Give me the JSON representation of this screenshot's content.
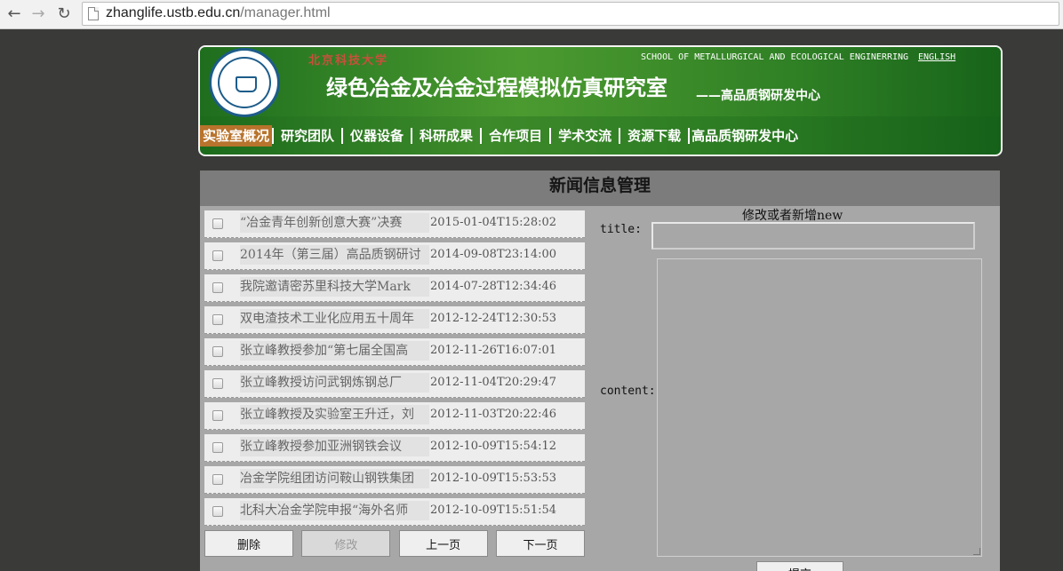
{
  "browser": {
    "url_host": "zhanglife.ustb.edu.cn",
    "url_path": "/manager.html"
  },
  "header": {
    "university": "北京科技大学",
    "school_en": "SCHOOL OF METALLURGICAL AND ECOLOGICAL ENGINERRING",
    "english_link": "ENGLISH",
    "lab_title": "绿色冶金及冶金过程模拟仿真研究室",
    "lab_subtitle": "——高品质钢研发中心",
    "menu": [
      {
        "label": "实验室概况",
        "active": true
      },
      {
        "label": "研究团队"
      },
      {
        "label": "仪器设备"
      },
      {
        "label": "科研成果"
      },
      {
        "label": "合作项目"
      },
      {
        "label": "学术交流"
      },
      {
        "label": "资源下载"
      },
      {
        "label": "高品质钢研发中心"
      }
    ]
  },
  "panel": {
    "title": "新闻信息管理",
    "news": [
      {
        "title": " “冶金青年创新创意大赛”决赛",
        "date": "2015-01-04T15:28:02"
      },
      {
        "title": "2014年（第三届）高品质钢研讨",
        "date": "2014-09-08T23:14:00"
      },
      {
        "title": " 我院邀请密苏里科技大学Mark ",
        "date": "2014-07-28T12:34:46"
      },
      {
        "title": "双电渣技术工业化应用五十周年",
        "date": "2012-12-24T12:30:53"
      },
      {
        "title": "张立峰教授参加“第七届全国高",
        "date": "2012-11-26T16:07:01"
      },
      {
        "title": " 张立峰教授访问武钢炼钢总厂 ",
        "date": "2012-11-04T20:29:47"
      },
      {
        "title": "张立峰教授及实验室王升迁，刘",
        "date": "2012-11-03T20:22:46"
      },
      {
        "title": " 张立峰教授参加亚洲钢铁会议 ",
        "date": "2012-10-09T15:54:12"
      },
      {
        "title": "冶金学院组团访问鞍山钢铁集团",
        "date": "2012-10-09T15:53:53"
      },
      {
        "title": "北科大冶金学院申报“海外名师",
        "date": "2012-10-09T15:51:54"
      }
    ],
    "buttons": {
      "delete": "删除",
      "modify": "修改",
      "prev": "上一页",
      "next": "下一页"
    },
    "editor": {
      "heading": "修改或者新增new",
      "title_label": "title:",
      "title_value": "",
      "content_label": "content:",
      "content_value": "",
      "submit": "提交"
    }
  }
}
